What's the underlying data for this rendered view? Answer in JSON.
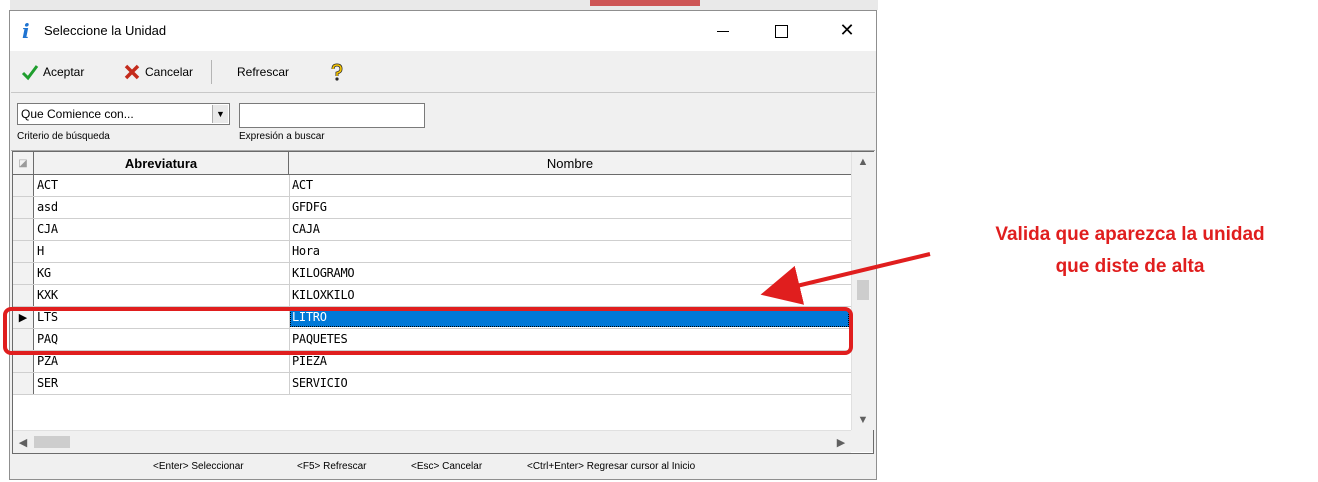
{
  "window": {
    "title": "Seleccione la Unidad",
    "icon": "info-icon"
  },
  "toolbar": {
    "accept_label": "Aceptar",
    "cancel_label": "Cancelar",
    "refresh_label": "Refrescar",
    "help_icon": "help-icon"
  },
  "search": {
    "criteria_value": "Que Comience con...",
    "criteria_label": "Criterio de búsqueda",
    "expression_value": "",
    "expression_label": "Expresión a buscar"
  },
  "grid": {
    "columns": [
      "Abreviatura",
      "Nombre"
    ],
    "rows": [
      {
        "abreviatura": "ACT",
        "nombre": "ACT"
      },
      {
        "abreviatura": "asd",
        "nombre": "GFDFG"
      },
      {
        "abreviatura": "CJA",
        "nombre": "CAJA"
      },
      {
        "abreviatura": "H",
        "nombre": "Hora"
      },
      {
        "abreviatura": "KG",
        "nombre": "KILOGRAMO"
      },
      {
        "abreviatura": "KXK",
        "nombre": "KILOXKILO"
      },
      {
        "abreviatura": "LTS",
        "nombre": "LITRO"
      },
      {
        "abreviatura": "PAQ",
        "nombre": "PAQUETES"
      },
      {
        "abreviatura": "PZA",
        "nombre": "PIEZA"
      },
      {
        "abreviatura": "SER",
        "nombre": "SERVICIO"
      }
    ],
    "selected_row": 6
  },
  "statusbar": {
    "hint1": "<Enter> Seleccionar",
    "hint2": "<F5> Refrescar",
    "hint3": "<Esc> Cancelar",
    "hint4": "<Ctrl+Enter> Regresar cursor al Inicio"
  },
  "annotation": {
    "line1": "Valida que aparezca la unidad",
    "line2": "que diste de alta",
    "color": "#e01e1e"
  },
  "colors": {
    "selection": "#0078d7",
    "accept_check": "#1f9e2e",
    "cancel_x": "#c42b1c"
  }
}
